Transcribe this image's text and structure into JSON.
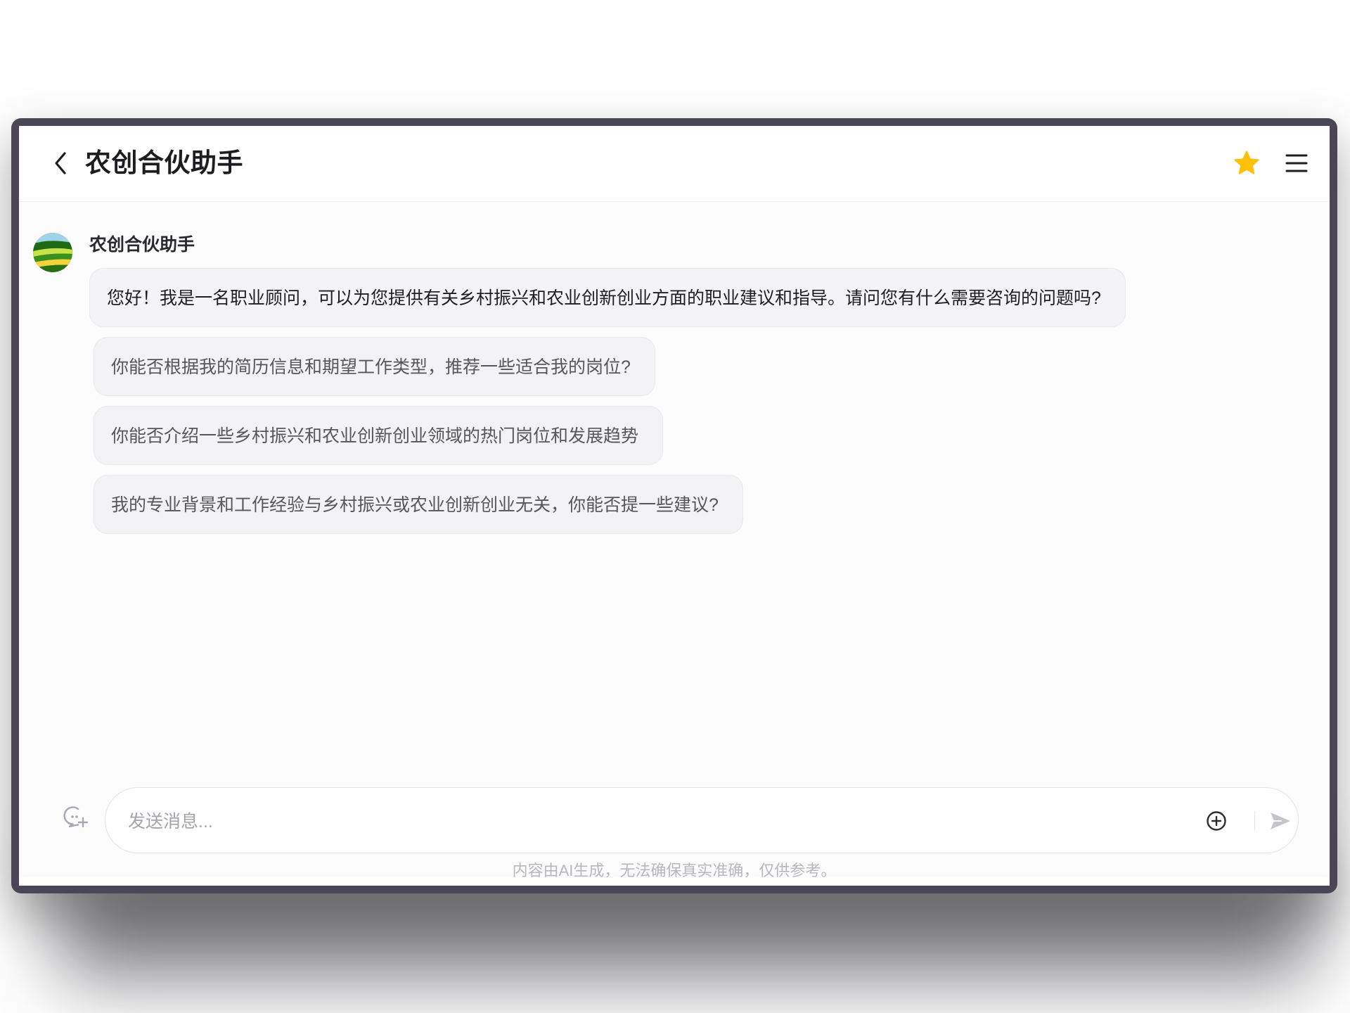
{
  "header": {
    "title": "农创合伙助手",
    "back_icon": "chevron-left-icon",
    "favorite_icon": "star-icon",
    "menu_icon": "menu-icon"
  },
  "colors": {
    "star": "#FFC107",
    "text_primary": "#1d1d1f",
    "bubble_bg": "#f4f4f6"
  },
  "chat": {
    "bot_name": "农创合伙助手",
    "greeting": "您好！我是一名职业顾问，可以为您提供有关乡村振兴和农业创新创业方面的职业建议和指导。请问您有什么需要咨询的问题吗?",
    "suggestions": [
      "你能否根据我的简历信息和期望工作类型，推荐一些适合我的岗位?",
      "你能否介绍一些乡村振兴和农业创新创业领域的热门岗位和发展趋势",
      "我的专业背景和工作经验与乡村振兴或农业创新创业无关，你能否提一些建议?"
    ]
  },
  "composer": {
    "placeholder": "发送消息...",
    "value": ""
  },
  "footer": {
    "disclaimer": "内容由AI生成，无法确保真实准确，仅供参考。"
  }
}
